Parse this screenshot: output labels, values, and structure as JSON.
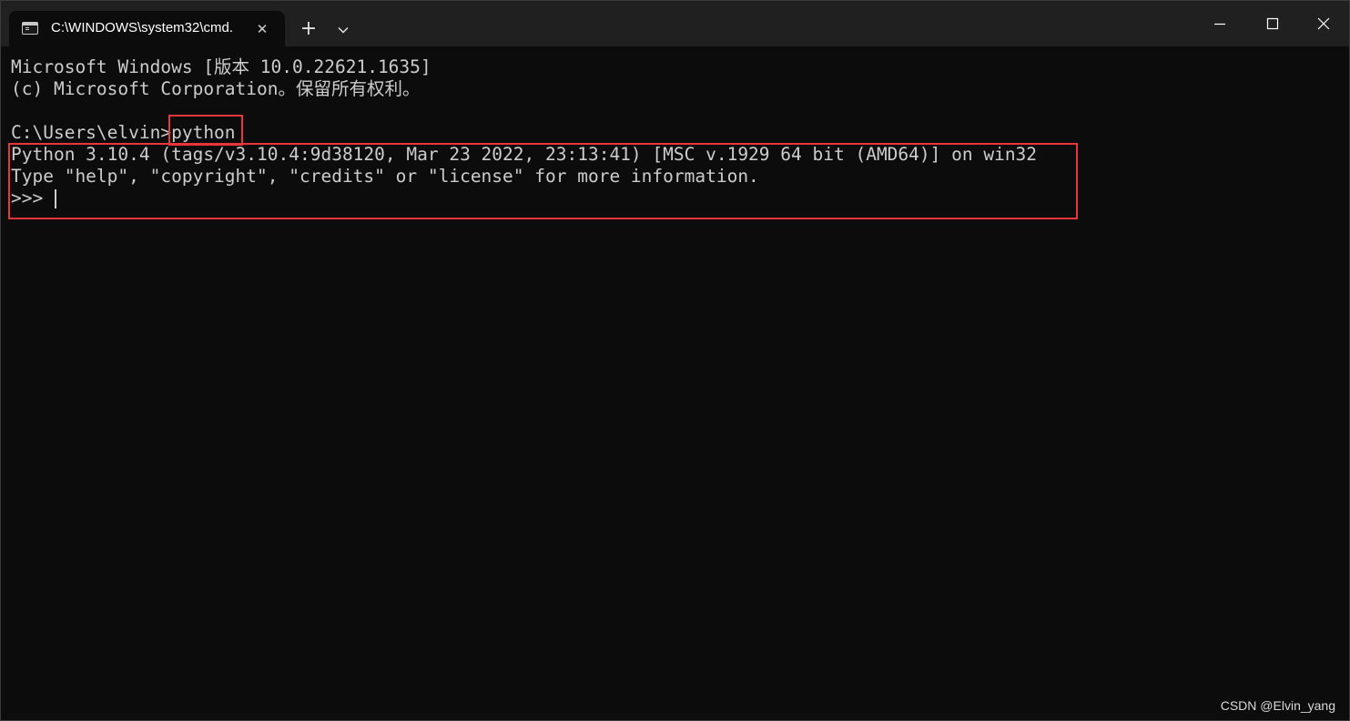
{
  "window": {
    "tab_title": "C:\\WINDOWS\\system32\\cmd.",
    "tab_icon": "terminal-icon",
    "close_tab_glyph": "✕",
    "new_tab_glyph": "+",
    "dropdown_icon": "chevron-down-icon",
    "minimize_icon": "minimize-icon",
    "maximize_icon": "maximize-icon",
    "close_icon": "close-icon"
  },
  "terminal": {
    "lines": [
      "Microsoft Windows [版本 10.0.22621.1635]",
      "(c) Microsoft Corporation。保留所有权利。",
      "",
      "C:\\Users\\elvin>python",
      "Python 3.10.4 (tags/v3.10.4:9d38120, Mar 23 2022, 23:13:41) [MSC v.1929 64 bit (AMD64)] on win32",
      "Type \"help\", \"copyright\", \"credits\" or \"license\" for more information.",
      ">>> "
    ]
  },
  "annotation": {
    "color": "#e8363a"
  },
  "watermark": "CSDN @Elvin_yang",
  "colors": {
    "background": "#0c0c0c",
    "titlebar": "#202020",
    "text": "#cccccc"
  }
}
